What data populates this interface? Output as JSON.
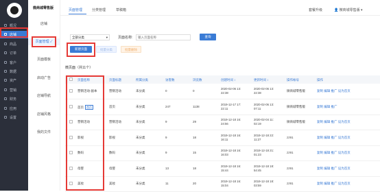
{
  "sidebar": {
    "items": [
      {
        "label": "概况"
      },
      {
        "label": "店铺"
      },
      {
        "label": "商品"
      },
      {
        "label": "订单"
      },
      {
        "label": "客户"
      },
      {
        "label": "数据"
      },
      {
        "label": "资产"
      },
      {
        "label": "营销"
      },
      {
        "label": "财务"
      },
      {
        "label": "应用"
      },
      {
        "label": "设置"
      }
    ]
  },
  "secondary": {
    "title": "微商城零售版",
    "items": [
      {
        "label": "店铺"
      },
      {
        "label": "页面管理 ✓"
      },
      {
        "label": "页面模板"
      },
      {
        "label": "启动广告"
      },
      {
        "label": "店铺导航"
      },
      {
        "label": "店铺风格"
      },
      {
        "label": "我的文件"
      }
    ]
  },
  "topbar": {
    "tabs": [
      {
        "label": "页面管理"
      },
      {
        "label": "分类管理"
      },
      {
        "label": "草稿箱"
      }
    ],
    "upgrade": "套餐升级",
    "user": "微商城零售版"
  },
  "filter": {
    "category_select": "全部分类",
    "name_label": "页面名称:",
    "name_placeholder": "输入页面名称",
    "search_button": "查询"
  },
  "actions": {
    "new_page": "新建页面",
    "batch_category": "批量分类",
    "batch_delete": "批量删除"
  },
  "list": {
    "title": "微页面（共11个）",
    "headers": [
      "页面名称",
      "页面标题",
      "所属分类",
      "访客数",
      "浏览数",
      "创建时间 ↕",
      "更新时间 ↕",
      "操作帐号",
      "操作"
    ],
    "rows": [
      {
        "name": "营销活动-副本",
        "tag": "",
        "title": "营销活动",
        "category": "未分类",
        "visitors": "0",
        "views": "0",
        "created": [
          "2020-02-06 13:",
          "22:38"
        ],
        "updated": [
          "2020-02-06 13:",
          "22:38"
        ],
        "account": "微商城零售版",
        "ops": "复制 编辑 推广 设为首页"
      },
      {
        "name": "首页",
        "tag": "首页",
        "title": "首页",
        "category": "未分类",
        "visitors": "247",
        "views": "1138",
        "created": [
          "2019-12-17 17:",
          "22:11"
        ],
        "updated": [
          "2020-02-06 13:",
          "07:11"
        ],
        "account": "微商城零售版",
        "ops": "复制 编辑 推广"
      },
      {
        "name": "营销活动",
        "tag": "",
        "title": "营销活动",
        "category": "未分类",
        "visitors": "9",
        "views": "29",
        "created": [
          "2019-12-18 16:",
          "24:56"
        ],
        "updated": [
          "2020-02-04 11:",
          "02:19"
        ],
        "account": "微商城零售版",
        "ops": "复制 编辑 推广 设为首页"
      },
      {
        "name": "影视",
        "tag": "",
        "title": "影视",
        "category": "未分类",
        "visitors": "9",
        "views": "18",
        "created": [
          "2019-12-18 16:",
          "16:11"
        ],
        "updated": [
          "2019-12-18 22:",
          "11:27"
        ],
        "account": "zz91",
        "ops": "复制 编辑 推广 设为首页"
      },
      {
        "name": "数码",
        "tag": "",
        "title": "数码",
        "category": "未分类",
        "visitors": "9",
        "views": "15",
        "created": [
          "2019-12-18 16:",
          "16:03"
        ],
        "updated": [
          "2019-12-18 21:",
          "01:23"
        ],
        "account": "zz91",
        "ops": "复制 编辑 推广 设为首页"
      },
      {
        "name": "母婴",
        "tag": "",
        "title": "母婴",
        "category": "未分类",
        "visitors": "13",
        "views": "18",
        "created": [
          "2019-12-18 16:",
          "15:44"
        ],
        "updated": [
          "2019-12-18 18:",
          "54:45"
        ],
        "account": "zz91",
        "ops": "复制 编辑 推广 设为首页"
      },
      {
        "name": "美妆",
        "tag": "",
        "title": "美妆",
        "category": "未分类",
        "visitors": "11",
        "views": "20",
        "created": [
          "2019-12-18 16:",
          "15:04"
        ],
        "updated": [
          "2019-12-18 18:",
          "03:59"
        ],
        "account": "zz91",
        "ops": "复制 编辑 推广 设为首页"
      }
    ]
  },
  "colors": {
    "accent": "#3a7bd5",
    "sidebar_bg": "#2b2f3a",
    "highlight_box": "#e53935"
  }
}
